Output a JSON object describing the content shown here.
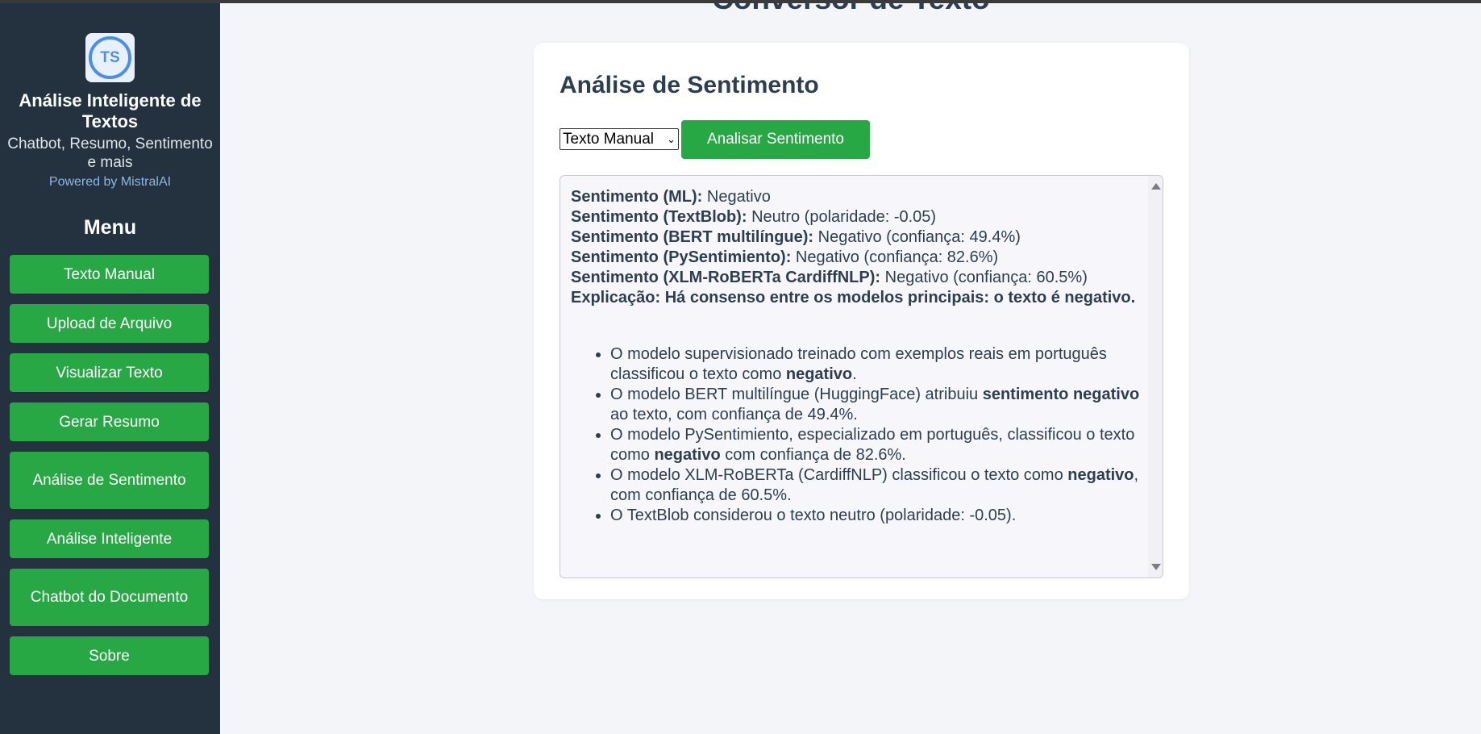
{
  "app": {
    "logo_text": "TS",
    "title": "Análise Inteligente de Textos",
    "subtitle": "Chatbot, Resumo, Sentimento e mais",
    "powered_by": "Powered by MistralAI"
  },
  "sidebar": {
    "menu_title": "Menu",
    "items": [
      {
        "label": "Texto Manual"
      },
      {
        "label": "Upload de Arquivo"
      },
      {
        "label": "Visualizar Texto"
      },
      {
        "label": "Gerar Resumo"
      },
      {
        "label": "Análise de Sentimento"
      },
      {
        "label": "Análise Inteligente"
      },
      {
        "label": "Chatbot do Documento"
      },
      {
        "label": "Sobre"
      }
    ]
  },
  "page": {
    "heading": "Conversor de Texto"
  },
  "card": {
    "title": "Análise de Sentimento",
    "select_value": "Texto Manual",
    "analyze_button": "Analisar Sentimento"
  },
  "result": {
    "lines": [
      {
        "label": "Sentimento (ML):",
        "value": "Negativo"
      },
      {
        "label": "Sentimento (TextBlob):",
        "value": "Neutro (polaridade: -0.05)"
      },
      {
        "label": "Sentimento (BERT multilíngue):",
        "value": "Negativo (confiança: 49.4%)"
      },
      {
        "label": "Sentimento (PySentimiento):",
        "value": "Negativo (confiança: 82.6%)"
      },
      {
        "label": "Sentimento (XLM-RoBERTa CardiffNLP):",
        "value": "Negativo (confiança: 60.5%)"
      }
    ],
    "explanation": "Explicação: Há consenso entre os modelos principais: o texto é negativo.",
    "bullets": [
      {
        "a": "O modelo supervisionado treinado com exemplos reais em português classificou o texto como ",
        "b": "negativo",
        "c": "."
      },
      {
        "a": "O modelo BERT multilíngue (HuggingFace) atribuiu ",
        "b": "sentimento negativo",
        "c": " ao texto, com confiança de 49.4%."
      },
      {
        "a": "O modelo PySentimiento, especializado em português, classificou o texto como ",
        "b": "negativo",
        "c": " com confiança de 82.6%."
      },
      {
        "a": "O modelo XLM-RoBERTa (CardiffNLP) classificou o texto como ",
        "b": "negativo",
        "c": ", com confiança de 60.5%."
      },
      {
        "a": "O TextBlob considerou o texto neutro (polaridade: -0.05).",
        "b": "",
        "c": ""
      }
    ]
  },
  "colors": {
    "sidebar_bg": "#243240",
    "accent_green": "#28a745",
    "page_bg": "#f4f5f9",
    "text_dark": "#2c3e50",
    "link_blue": "#8bb6e6"
  }
}
